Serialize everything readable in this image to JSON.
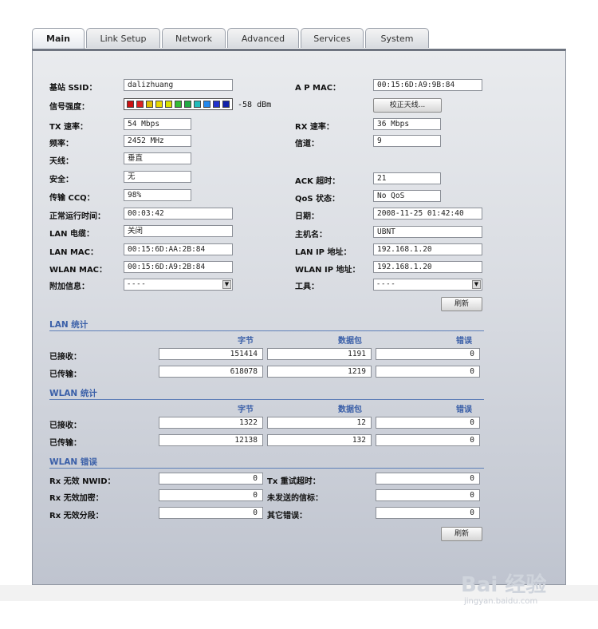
{
  "tabs": [
    "Main",
    "Link Setup",
    "Network",
    "Advanced",
    "Services",
    "System"
  ],
  "status": {
    "ssid_label": "基站 SSID：",
    "ssid": "dalizhuang",
    "ap_mac_label": "A P MAC：",
    "ap_mac": "00:15:6D:A9:9B:84",
    "signal_label": "信号强度：",
    "signal_value": "-58 dBm",
    "align_button": "校正天线...",
    "tx_rate_label": "TX 速率：",
    "tx_rate": "54 Mbps",
    "rx_rate_label": "RX 速率：",
    "rx_rate": "36 Mbps",
    "freq_label": "频率：",
    "freq": "2452 MHz",
    "channel_label": "信道：",
    "channel": "9",
    "antenna_label": "天线：",
    "antenna": "垂直",
    "security_label": "安全：",
    "security": "无",
    "ack_label": "ACK 超时：",
    "ack": "21",
    "ccq_label": "传输 CCQ：",
    "ccq": "98%",
    "qos_label": "QoS 状态：",
    "qos": "No QoS",
    "uptime_label": "正常运行时间：",
    "uptime": "00:03:42",
    "date_label": "日期：",
    "date": "2008-11-25 01:42:40",
    "lan_cable_label": "LAN 电缆：",
    "lan_cable": "关闭",
    "hostname_label": "主机名：",
    "hostname": "UBNT",
    "lan_mac_label": "LAN MAC：",
    "lan_mac": "00:15:6D:AA:2B:84",
    "lan_ip_label": "LAN IP 地址：",
    "lan_ip": "192.168.1.20",
    "wlan_mac_label": "WLAN MAC：",
    "wlan_mac": "00:15:6D:A9:2B:84",
    "wlan_ip_label": "WLAN IP 地址：",
    "wlan_ip": "192.168.1.20",
    "extra_label": "附加信息：",
    "extra": "- - - -",
    "tools_label": "工具：",
    "tools": "- - - -",
    "refresh": "刷新"
  },
  "signal_colors": [
    "#cc1111",
    "#dd2222",
    "#e0c000",
    "#e8d800",
    "#d9e000",
    "#33bb33",
    "#22aa44",
    "#22bbbb",
    "#2288ee",
    "#2233cc",
    "#1122aa"
  ],
  "lan_stats": {
    "title": "LAN 统计",
    "headers": [
      "字节",
      "数据包",
      "错误"
    ],
    "rows": [
      {
        "label": "已接收：",
        "bytes": "151414",
        "packets": "1191",
        "errors": "0"
      },
      {
        "label": "已传输：",
        "bytes": "618078",
        "packets": "1219",
        "errors": "0"
      }
    ]
  },
  "wlan_stats": {
    "title": "WLAN 统计",
    "headers": [
      "字节",
      "数据包",
      "错误"
    ],
    "rows": [
      {
        "label": "已接收：",
        "bytes": "1322",
        "packets": "12",
        "errors": "0"
      },
      {
        "label": "已传输：",
        "bytes": "12138",
        "packets": "132",
        "errors": "0"
      }
    ]
  },
  "wlan_errors": {
    "title": "WLAN 错误",
    "rows": [
      {
        "label": "Rx 无效 NWID：",
        "value": "0",
        "label2": "Tx 重试超时：",
        "value2": "0"
      },
      {
        "label": "Rx 无效加密：",
        "value": "0",
        "label2": "未发送的信标：",
        "value2": "0"
      },
      {
        "label": "Rx 无效分段：",
        "value": "0",
        "label2": "其它错误：",
        "value2": "0"
      }
    ],
    "refresh": "刷新"
  },
  "watermark": {
    "logo": "Bai 经验",
    "url": "jingyan.baidu.com"
  }
}
